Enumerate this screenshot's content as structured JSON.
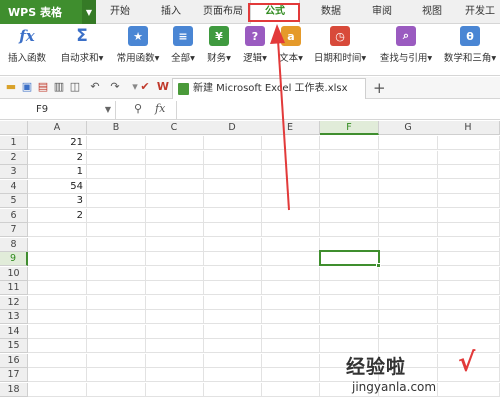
{
  "app": {
    "name": "WPS 表格"
  },
  "menu": [
    "开始",
    "插入",
    "页面布局",
    "公式",
    "数据",
    "审阅",
    "视图",
    "开发工"
  ],
  "active_menu": "公式",
  "ribbon": [
    {
      "label": "插入函数",
      "icon": "fx-icon",
      "glyph": "fx"
    },
    {
      "label": "自动求和▾",
      "icon": "sigma-icon",
      "glyph": "Σ"
    },
    {
      "label": "常用函数▾",
      "icon": "star-function-icon",
      "glyph": "★"
    },
    {
      "label": "全部▾",
      "icon": "book-icon",
      "glyph": "≡"
    },
    {
      "label": "财务▾",
      "icon": "finance-icon",
      "glyph": "¥"
    },
    {
      "label": "逻辑▾",
      "icon": "logic-icon",
      "glyph": "?"
    },
    {
      "label": "文本▾",
      "icon": "text-icon",
      "glyph": "a"
    },
    {
      "label": "日期和时间▾",
      "icon": "clock-icon",
      "glyph": "◷"
    },
    {
      "label": "查找与引用▾",
      "icon": "lookup-icon",
      "glyph": "⌕"
    },
    {
      "label": "数学和三角▾",
      "icon": "math-icon",
      "glyph": "θ"
    }
  ],
  "document": {
    "tab_title": "新建 Microsoft Excel 工作表.xlsx"
  },
  "formula_bar": {
    "name_box": "F9",
    "fx": "fx",
    "content": ""
  },
  "columns": [
    "A",
    "B",
    "C",
    "D",
    "E",
    "F",
    "G",
    "H"
  ],
  "selected_column": "F",
  "rows": [
    "1",
    "2",
    "3",
    "4",
    "5",
    "6",
    "7",
    "8",
    "9",
    "10",
    "11",
    "12",
    "13",
    "14",
    "15",
    "16",
    "17",
    "18"
  ],
  "selected_row": "9",
  "cells": {
    "A1": "21",
    "A2": "2",
    "A3": "1",
    "A4": "54",
    "A5": "3",
    "A6": "2"
  },
  "watermark": {
    "title": "经验啦",
    "check": "√",
    "url": "jingyanla.com"
  },
  "colors": {
    "wps_green": "#3f8e2e",
    "annotation_red": "#e23a3a"
  }
}
